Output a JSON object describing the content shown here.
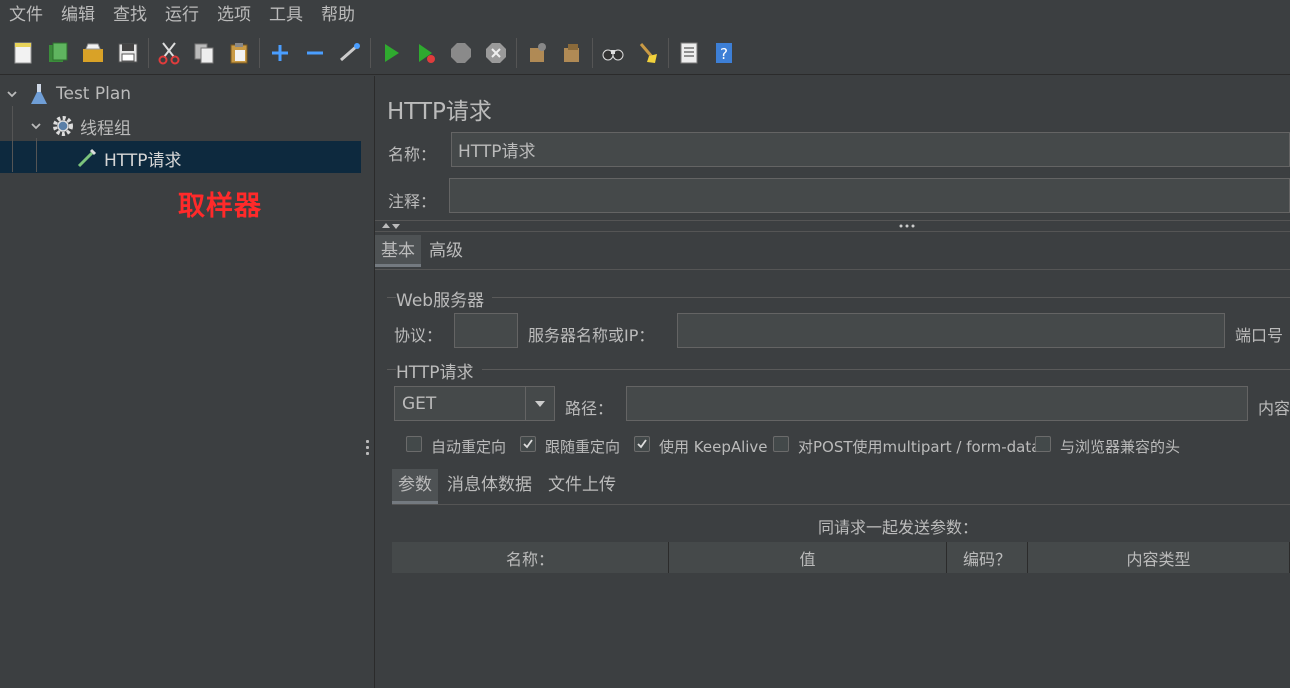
{
  "menu": [
    "文件",
    "编辑",
    "查找",
    "运行",
    "选项",
    "工具",
    "帮助"
  ],
  "toolbar_icons": [
    "new-icon",
    "templates-icon",
    "open-icon",
    "save-icon",
    "cut-icon",
    "copy-icon",
    "paste-icon",
    "expand-icon",
    "collapse-icon",
    "toggle-icon",
    "start-icon",
    "start-no-pause-icon",
    "stop-icon",
    "shutdown-icon",
    "clear-icon",
    "clear-all-icon",
    "search-icon",
    "reset-search-icon",
    "function-helper-icon",
    "help-icon"
  ],
  "tree": {
    "root": "Test Plan",
    "thread_group": "线程组",
    "sampler": "HTTP请求"
  },
  "annotation": "取样器",
  "panel": {
    "title": "HTTP请求",
    "name_label": "名称：",
    "name_value": "HTTP请求",
    "comment_label": "注释：",
    "comment_value": ""
  },
  "tabs": [
    "基本",
    "高级"
  ],
  "web_server": {
    "group_title": "Web服务器",
    "protocol_label": "协议：",
    "protocol_value": "",
    "server_label": "服务器名称或IP：",
    "server_value": "",
    "port_label": "端口号"
  },
  "http_request": {
    "group_title": "HTTP请求",
    "method": "GET",
    "path_label": "路径：",
    "path_value": "",
    "content_label": "内容"
  },
  "checkboxes": [
    {
      "label": "自动重定向",
      "checked": false
    },
    {
      "label": "跟随重定向",
      "checked": true
    },
    {
      "label": "使用 KeepAlive",
      "checked": true
    },
    {
      "label": "对POST使用multipart / form-data",
      "checked": false
    },
    {
      "label": "与浏览器兼容的头",
      "checked": false
    }
  ],
  "sub_tabs": [
    "参数",
    "消息体数据",
    "文件上传"
  ],
  "params_table": {
    "caption": "同请求一起发送参数：",
    "columns": [
      "名称：",
      "值",
      "编码？",
      "内容类型"
    ]
  },
  "colors": {
    "background": "#3c3f41",
    "selection": "#0d293e",
    "annotation": "#ff2a2a"
  }
}
